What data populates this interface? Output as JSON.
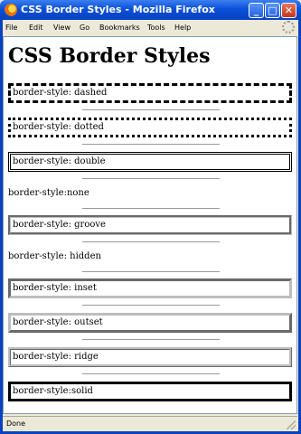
{
  "window": {
    "title": "CSS Border Styles - Mozilla Firefox",
    "buttons": {
      "minimize": "_",
      "maximize": "□",
      "close": "✕"
    }
  },
  "menu": {
    "items": [
      "File",
      "Edit",
      "View",
      "Go",
      "Bookmarks",
      "Tools",
      "Help"
    ]
  },
  "page": {
    "title": "CSS Border Styles",
    "examples": [
      {
        "style": "dashed",
        "label": "border-style: dashed"
      },
      {
        "style": "dotted",
        "label": "border-style: dotted"
      },
      {
        "style": "double",
        "label": "border-style: double"
      },
      {
        "style": "none",
        "label": "border-style:none"
      },
      {
        "style": "groove",
        "label": "border-style: groove"
      },
      {
        "style": "hidden",
        "label": "border-style: hidden"
      },
      {
        "style": "inset",
        "label": "border-style: inset"
      },
      {
        "style": "outset",
        "label": "border-style: outset"
      },
      {
        "style": "ridge",
        "label": "border-style: ridge"
      },
      {
        "style": "solid",
        "label": "border-style:solid"
      }
    ]
  },
  "status": {
    "text": "Done"
  },
  "icons": {
    "app": "firefox-icon",
    "throbber": "throbber-icon",
    "grip": "resize-grip-icon"
  }
}
